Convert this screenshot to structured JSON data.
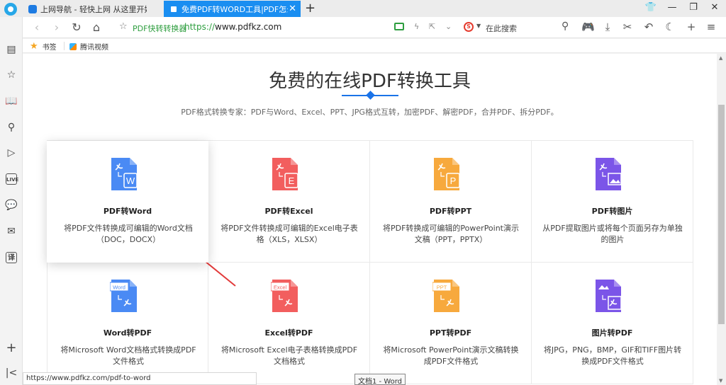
{
  "tabs": [
    {
      "title": "上网导航 - 轻快上网 从这里开始",
      "active": false
    },
    {
      "title": "免费PDF转WORD工具|PDF怎么转换",
      "active": true
    }
  ],
  "address": {
    "site_name": "PDF快转转换器",
    "protocol": "https://",
    "url": "www.pdfkz.com"
  },
  "search": {
    "placeholder": "在此搜索",
    "engine_icon": "sogou-s-icon"
  },
  "bookmarks": [
    {
      "label": "书签",
      "icon": "star-icon"
    },
    {
      "label": "腾讯视频",
      "icon": "tencent-video-icon"
    }
  ],
  "page": {
    "title": "免费的在线PDF转换工具",
    "subtitle": "PDF格式转换专家：PDF与Word、Excel、PPT、JPG格式互转，加密PDF、解密PDF，合并PDF、拆分PDF。"
  },
  "tools": [
    {
      "name": "PDF转Word",
      "desc": "将PDF文件转换成可编辑的Word文档（DOC，DOCX）",
      "color": "#4a8af4",
      "badge": "W",
      "badge_pos": "corner"
    },
    {
      "name": "PDF转Excel",
      "desc": "将PDF文件转换成可编辑的Excel电子表格（XLS，XLSX）",
      "color": "#f25e5e",
      "badge": "E",
      "badge_pos": "corner"
    },
    {
      "name": "PDF转PPT",
      "desc": "将PDF转换成可编辑的PowerPoint演示文稿（PPT，PPTX）",
      "color": "#f7a93d",
      "badge": "P",
      "badge_pos": "corner"
    },
    {
      "name": "PDF转图片",
      "desc": "从PDF提取图片或将每个页面另存为单独的图片",
      "color": "#7b55e8",
      "badge": "",
      "badge_pos": "image"
    },
    {
      "name": "Word转PDF",
      "desc": "将Microsoft Word文档格式转换成PDF文件格式",
      "color": "#4a8af4",
      "badge": "Word",
      "badge_pos": "tag"
    },
    {
      "name": "Excel转PDF",
      "desc": "将Microsoft Excel电子表格转换成PDF文档格式",
      "color": "#f25e5e",
      "badge": "Excel",
      "badge_pos": "tag"
    },
    {
      "name": "PPT转PDF",
      "desc": "将Microsoft PowerPoint演示文稿转换成PDF文件格式",
      "color": "#f7a93d",
      "badge": "PPT",
      "badge_pos": "tag"
    },
    {
      "name": "图片转PDF",
      "desc": "将JPG，PNG，BMP，GIF和TIFF图片转换成PDF文件格式",
      "color": "#7b55e8",
      "badge": "",
      "badge_pos": "image-top"
    }
  ],
  "status_url": "https://www.pdfkz.com/pdf-to-word",
  "tooltip": "文档1 - Word"
}
